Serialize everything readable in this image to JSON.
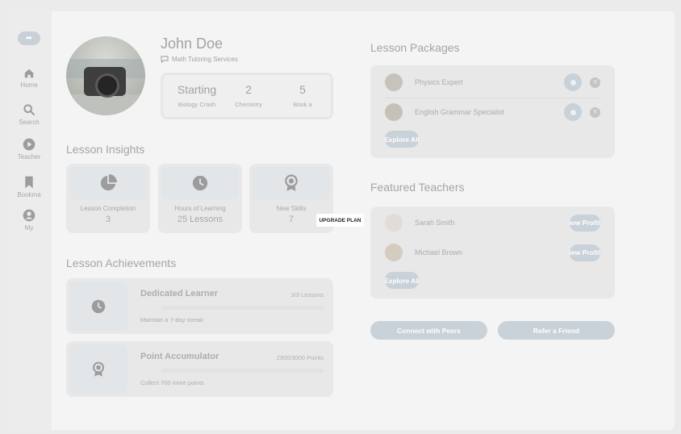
{
  "profile": {
    "name": "John Doe",
    "subtitle": "Math Tutoring Services",
    "stats": [
      {
        "value": "Starting",
        "label": "Biology Crash"
      },
      {
        "value": "2",
        "label": "Chemistry"
      },
      {
        "value": "5",
        "label": "Book a"
      }
    ]
  },
  "sidebar": {
    "top_button_icon": "reply-icon",
    "items": [
      {
        "label": "Home",
        "icon": "home-icon"
      },
      {
        "label": "Search",
        "icon": "search-icon"
      },
      {
        "label": "Teacher",
        "icon": "play-icon"
      },
      {
        "label": "Bookma",
        "icon": "bookmark-icon"
      },
      {
        "label": "My",
        "icon": "user-icon"
      }
    ]
  },
  "insights": {
    "title": "Lesson Insights",
    "cards": [
      {
        "label": "Lesson Completion",
        "value": "3",
        "icon": "pie-chart-icon"
      },
      {
        "label": "Hours of Learning",
        "value": "25 Lessons",
        "icon": "clock-icon"
      },
      {
        "label": "New Skills",
        "value": "7",
        "icon": "award-icon"
      }
    ],
    "tooltip": "UPGRADE PLAN"
  },
  "achievements": {
    "title": "Lesson Achievements",
    "items": [
      {
        "title": "Dedicated Learner",
        "progress_text": "3/3 Lessons",
        "progress": 1.0,
        "description": "Maintain a 7-day streak",
        "icon": "clock-icon"
      },
      {
        "title": "Point Accumulator",
        "progress_text": "2300/3000 Points",
        "progress": 0.77,
        "description": "Collect 700 more points",
        "icon": "award-icon"
      }
    ]
  },
  "packages": {
    "title": "Lesson Packages",
    "items": [
      {
        "name": "Physics Expert"
      },
      {
        "name": "English Grammar Specialist"
      }
    ],
    "explore_label": "Explore All"
  },
  "teachers": {
    "title": "Featured Teachers",
    "items": [
      {
        "name": "Sarah Smith",
        "button": "View Profile"
      },
      {
        "name": "Michael Brown",
        "button": "View Profile"
      }
    ],
    "explore_label": "Explore All"
  },
  "actions": {
    "connect_label": "Connect with Peers",
    "refer_label": "Refer a Friend"
  },
  "colors": {
    "accent": "#c9d1d9",
    "background": "#f4f4f4",
    "card": "#e8e8e8"
  }
}
